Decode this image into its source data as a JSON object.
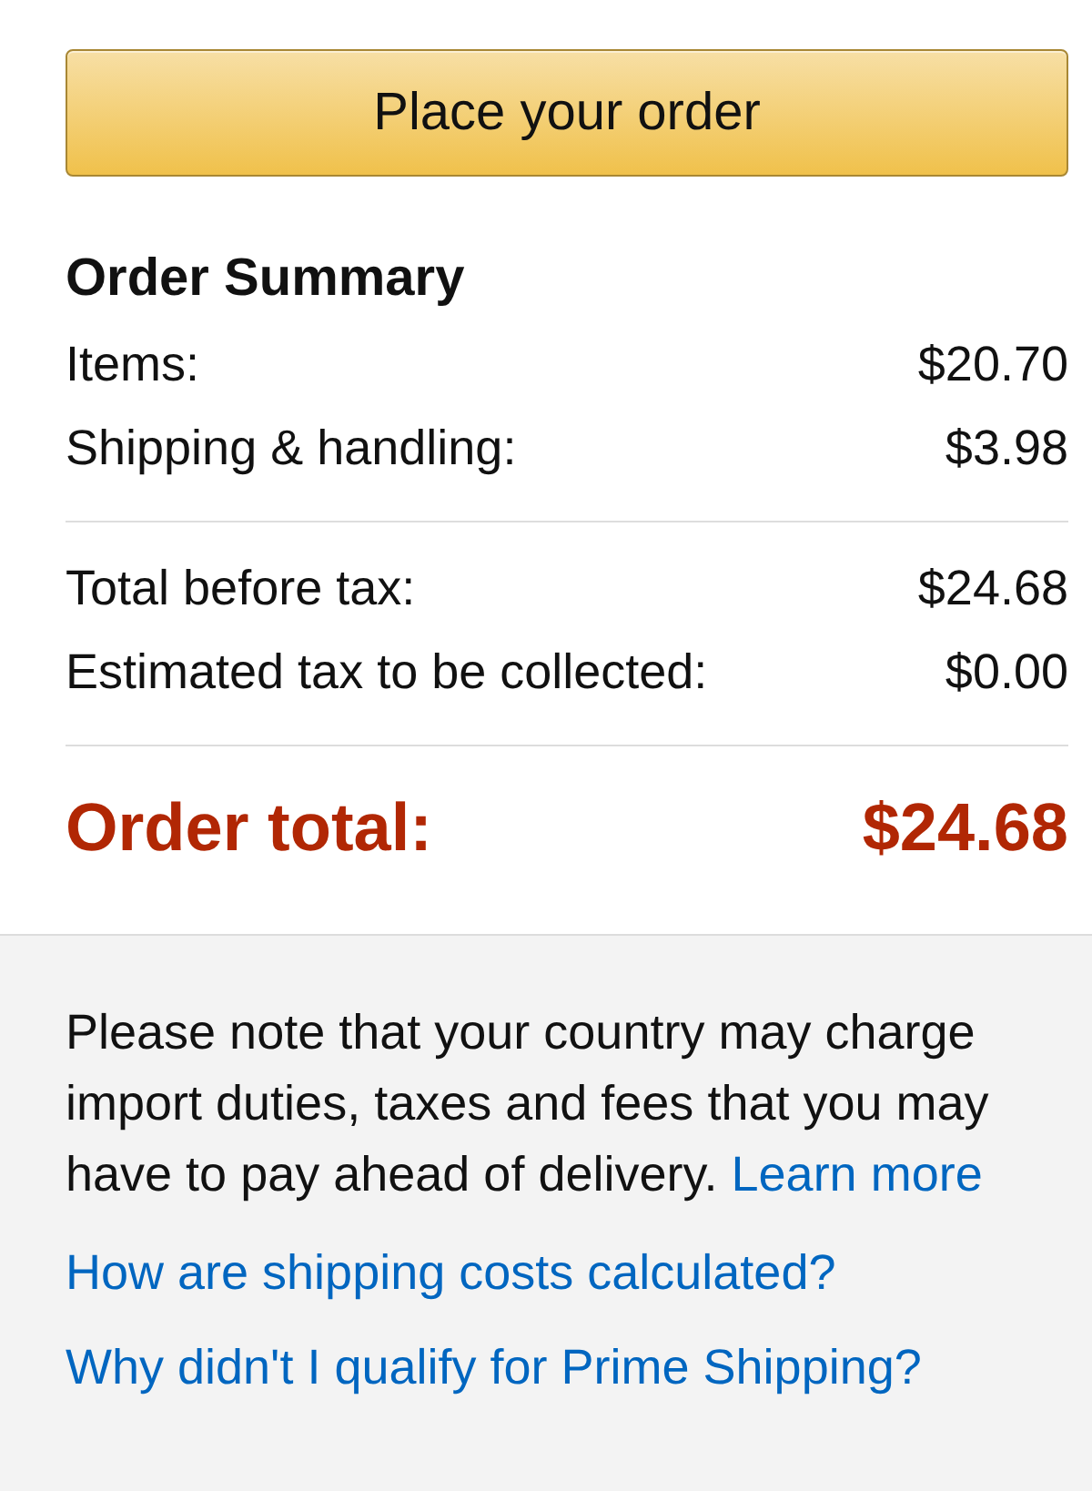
{
  "place_order_button": {
    "label": "Place your order"
  },
  "order_summary": {
    "title": "Order Summary",
    "groups": [
      [
        {
          "label": "Items:",
          "amount": "$20.70"
        },
        {
          "label": "Shipping & handling:",
          "amount": "$3.98"
        }
      ],
      [
        {
          "label": "Total before tax:",
          "amount": "$24.68"
        },
        {
          "label": "Estimated tax to be collected:",
          "amount": "$0.00"
        }
      ]
    ],
    "total": {
      "label": "Order total:",
      "amount": "$24.68"
    }
  },
  "notice": {
    "text": "Please note that your country may charge import duties, taxes and fees that you may have to pay ahead of delivery.",
    "link": "Learn more"
  },
  "help_links": [
    "How are shipping costs calculated?",
    "Why didn't I qualify for Prime Shipping?"
  ]
}
